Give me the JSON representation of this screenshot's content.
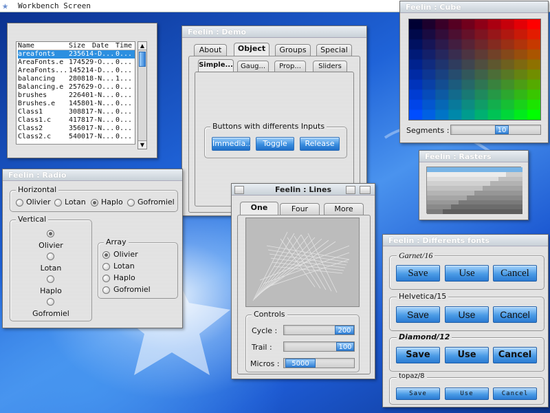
{
  "menubar": {
    "title": "Workbench Screen"
  },
  "filelist": {
    "headers": [
      "Name",
      "Size",
      "Date",
      "Time"
    ],
    "rows": [
      [
        "areafonts",
        "235614-D...",
        "0..."
      ],
      [
        "AreaFonts.e",
        "174529-O...",
        "0..."
      ],
      [
        "AreaFonts...",
        "145214-D...",
        "0..."
      ],
      [
        "balancing",
        "280818-N...",
        "1..."
      ],
      [
        "Balancing.e",
        "257629-O...",
        "0..."
      ],
      [
        "brushes",
        "226401-N...",
        "0..."
      ],
      [
        "Brushes.e",
        "145801-N...",
        "0..."
      ],
      [
        "Class1",
        "308817-N...",
        "0..."
      ],
      [
        "Class1.c",
        "417817-N...",
        "0..."
      ],
      [
        "Class2",
        "356017-N...",
        "0..."
      ],
      [
        "Class2.c",
        "540017-N...",
        "0..."
      ]
    ]
  },
  "demo": {
    "title": "Feelin : Demo",
    "tabs": [
      "About",
      "Object",
      "Groups",
      "Special"
    ],
    "subtabs": [
      "Simple...",
      "Gaug...",
      "Prop...",
      "Sliders"
    ],
    "group_label": "Buttons with differents Inputs",
    "buttons": [
      "Immedia...",
      "Toggle",
      "Release"
    ]
  },
  "radio": {
    "title": "Feelin : Radio",
    "horizontal_label": "Horizontal",
    "options": [
      "Olivier",
      "Lotan",
      "Haplo",
      "Gofromiel"
    ],
    "horizontal_selected": "Haplo",
    "vertical_label": "Vertical",
    "vertical_selected": "Olivier",
    "array_label": "Array",
    "array_selected": "Olivier"
  },
  "cube": {
    "title": "Feelin : Cube",
    "segments_label": "Segments :",
    "segments_value": "10"
  },
  "rasters": {
    "title": "Feelin : Rasters"
  },
  "lines": {
    "title": "Feelin : Lines",
    "tabs": [
      "One",
      "Four",
      "More"
    ],
    "controls_label": "Controls",
    "cycle_label": "Cycle :",
    "cycle_value": "200",
    "trail_label": "Trail :",
    "trail_value": "100",
    "micros_label": "Micros :",
    "micros_value": "5000"
  },
  "fonts": {
    "title": "Feelin : Differents fonts",
    "groups": [
      {
        "label": "Garnet/16",
        "buttons": [
          "Save",
          "Use",
          "Cancel"
        ]
      },
      {
        "label": "Helvetica/15",
        "buttons": [
          "Save",
          "Use",
          "Cancel"
        ]
      },
      {
        "label": "Diamond/12",
        "buttons": [
          "Save",
          "Use",
          "Cancel"
        ]
      },
      {
        "label": "topaz/8",
        "buttons": [
          "Save",
          "Use",
          "Cancel"
        ]
      }
    ]
  },
  "colors": {
    "accent": "#2c8fe0",
    "button_blue": "#3a8ee0"
  }
}
